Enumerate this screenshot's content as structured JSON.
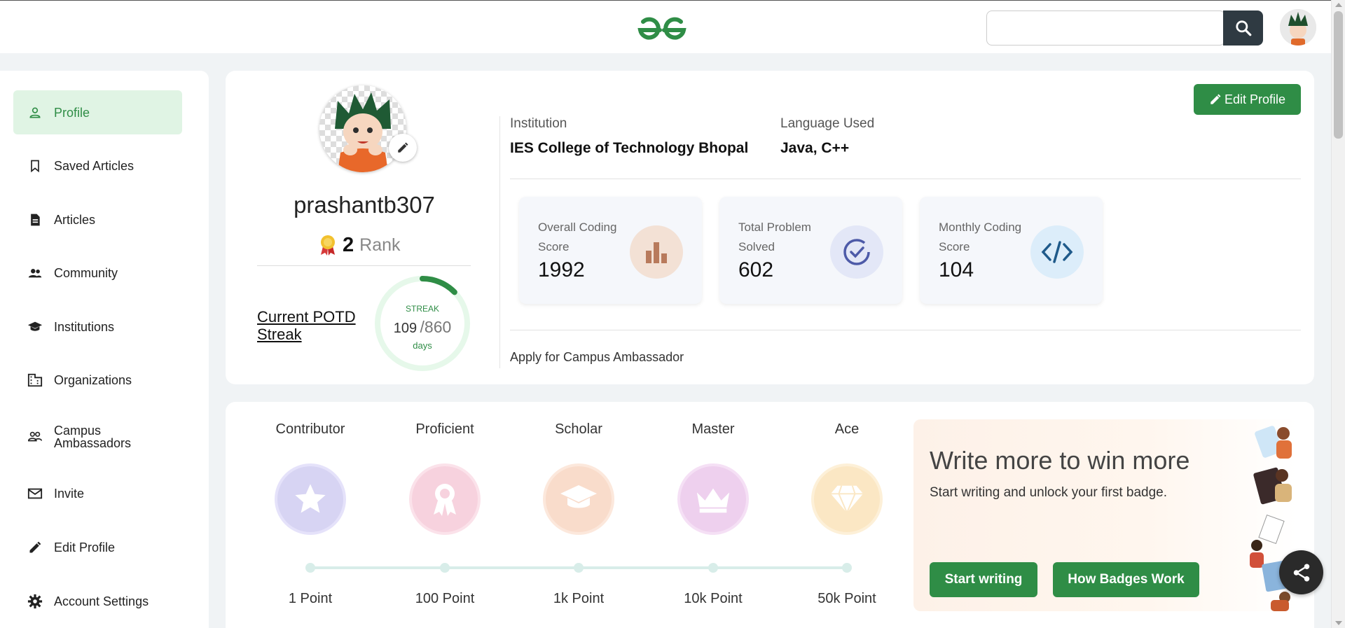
{
  "header": {
    "logo_alt": "GfG",
    "search": {
      "value": "",
      "placeholder": ""
    }
  },
  "sidebar": {
    "items": [
      {
        "label": "Profile",
        "icon": "person-icon",
        "active": true
      },
      {
        "label": "Saved Articles",
        "icon": "bookmark-icon"
      },
      {
        "label": "Articles",
        "icon": "document-icon"
      },
      {
        "label": "Community",
        "icon": "group-icon"
      },
      {
        "label": "Institutions",
        "icon": "school-icon"
      },
      {
        "label": "Organizations",
        "icon": "building-icon"
      },
      {
        "label": "Campus Ambassadors",
        "icon": "people-outline-icon"
      },
      {
        "label": "Invite",
        "icon": "mail-icon"
      },
      {
        "label": "Edit Profile",
        "icon": "pencil-icon"
      },
      {
        "label": "Account Settings",
        "icon": "gear-icon"
      }
    ]
  },
  "profile": {
    "username": "prashantb307",
    "rank_number": "2",
    "rank_label": "Rank",
    "potd_label": "Current POTD Streak",
    "streak": {
      "label": "STREAK",
      "current": "109",
      "total": "/860",
      "unit": "days",
      "progress_fraction": 0.127
    },
    "institution_label": "Institution",
    "institution_value": "IES College of Technology Bhopal",
    "language_label": "Language Used",
    "language_value": "Java, C++",
    "edit_button": "Edit Profile",
    "stats": [
      {
        "label": "Overall Coding Score",
        "value": "1992",
        "icon": "bar-chart-icon",
        "color": "#f3e1d5"
      },
      {
        "label": "Total Problem Solved",
        "value": "602",
        "icon": "check-circle-icon",
        "color": "#e3e7f7"
      },
      {
        "label": "Monthly Coding Score",
        "value": "104",
        "icon": "code-icon",
        "color": "#dcedfa"
      }
    ],
    "ambassador_link": "Apply for Campus Ambassador"
  },
  "badges": {
    "items": [
      {
        "title": "Contributor",
        "points": "1 Point",
        "icon": "star-icon",
        "color": "#d7d4f3"
      },
      {
        "title": "Proficient",
        "points": "100 Point",
        "icon": "ribbon-icon",
        "color": "#f7d2de"
      },
      {
        "title": "Scholar",
        "points": "1k Point",
        "icon": "graduation-cap-icon",
        "color": "#f9dccb"
      },
      {
        "title": "Master",
        "points": "10k Point",
        "icon": "crown-icon",
        "color": "#eed0ee"
      },
      {
        "title": "Ace",
        "points": "50k Point",
        "icon": "diamond-icon",
        "color": "#fbe7c4"
      }
    ],
    "promo": {
      "title": "Write more to win more",
      "subtitle": "Start writing and unlock your first badge.",
      "start_button": "Start writing",
      "how_button": "How Badges Work"
    }
  },
  "colors": {
    "brand_green": "#2f8d46",
    "dark": "#2f3a42"
  }
}
